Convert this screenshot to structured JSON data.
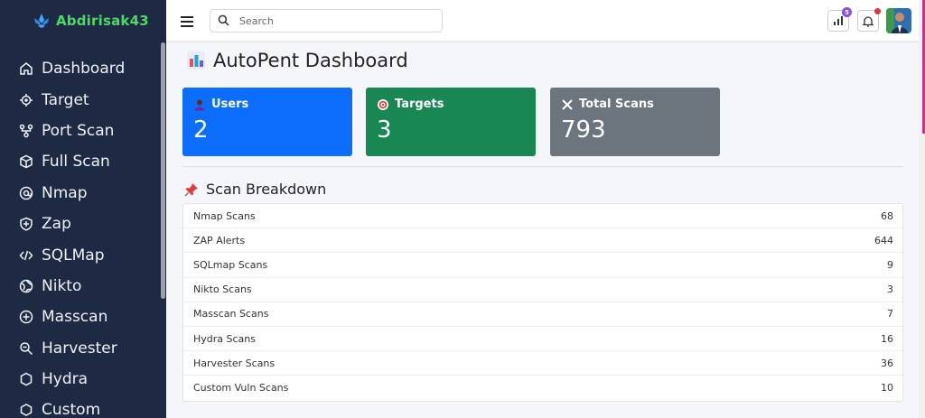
{
  "brand": {
    "name": "Abdirisak43"
  },
  "sidebar": {
    "items": [
      {
        "label": "Dashboard",
        "icon": "home-icon"
      },
      {
        "label": "Target",
        "icon": "crosshair-icon"
      },
      {
        "label": "Port Scan",
        "icon": "network-icon"
      },
      {
        "label": "Full Scan",
        "icon": "box-icon"
      },
      {
        "label": "Nmap",
        "icon": "at-icon"
      },
      {
        "label": "Zap",
        "icon": "shield-icon"
      },
      {
        "label": "SQLMap",
        "icon": "code-icon"
      },
      {
        "label": "Nikto",
        "icon": "globe-icon"
      },
      {
        "label": "Masscan",
        "icon": "plus-circle-icon"
      },
      {
        "label": "Harvester",
        "icon": "search-icon"
      },
      {
        "label": "Hydra",
        "icon": "hexagon-icon"
      },
      {
        "label": "Custom",
        "icon": "db-icon"
      }
    ]
  },
  "topbar": {
    "search_placeholder": "Search",
    "stats_badge": "5"
  },
  "main": {
    "title": "AutoPent Dashboard",
    "cards": [
      {
        "label": "Users",
        "value": "2",
        "color": "#0d6efd",
        "icon": "user-icon"
      },
      {
        "label": "Targets",
        "value": "3",
        "color": "#198754",
        "icon": "target-icon"
      },
      {
        "label": "Total Scans",
        "value": "793",
        "color": "#6c757d",
        "icon": "tools-icon"
      }
    ],
    "breakdown_title": "Scan Breakdown",
    "breakdown": [
      {
        "name": "Nmap Scans",
        "count": "68"
      },
      {
        "name": "ZAP Alerts",
        "count": "644"
      },
      {
        "name": "SQLmap Scans",
        "count": "9"
      },
      {
        "name": "Nikto Scans",
        "count": "3"
      },
      {
        "name": "Masscan Scans",
        "count": "7"
      },
      {
        "name": "Hydra Scans",
        "count": "16"
      },
      {
        "name": "Harvester Scans",
        "count": "36"
      },
      {
        "name": "Custom Vuln Scans",
        "count": "10"
      }
    ]
  },
  "colors": {
    "sidebar_bg": "#1e2a44",
    "brand": "#4cd964",
    "accent": "#e91ea0"
  }
}
